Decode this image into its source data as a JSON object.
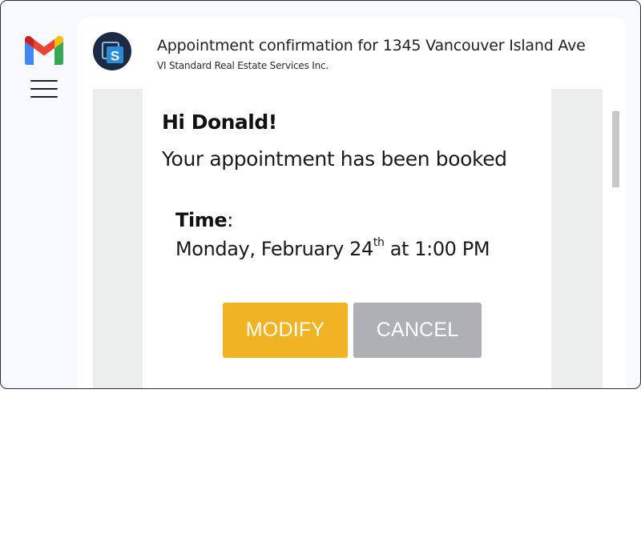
{
  "email": {
    "subject": "Appointment confirmation for 1345 Vancouver Island Ave",
    "sender": "VI Standard Real Estate Services Inc.",
    "sender_avatar_letter": "S"
  },
  "body": {
    "greeting": "Hi Donald!",
    "message": "Your appointment has been booked",
    "time_label": "Time",
    "time_colon": ":",
    "time_value_prefix": "Monday, February 24",
    "time_value_superscript": "th",
    "time_value_suffix": " at 1:00 PM"
  },
  "actions": {
    "modify_label": "MODIFY",
    "cancel_label": "CANCEL"
  },
  "colors": {
    "modify_button": "#f0b323",
    "cancel_button": "#afb0b5",
    "avatar_bg": "#1c2a44",
    "app_bg": "#f7f9fd"
  },
  "icons": {
    "app_logo": "gmail-logo-icon",
    "menu": "hamburger-menu-icon"
  }
}
